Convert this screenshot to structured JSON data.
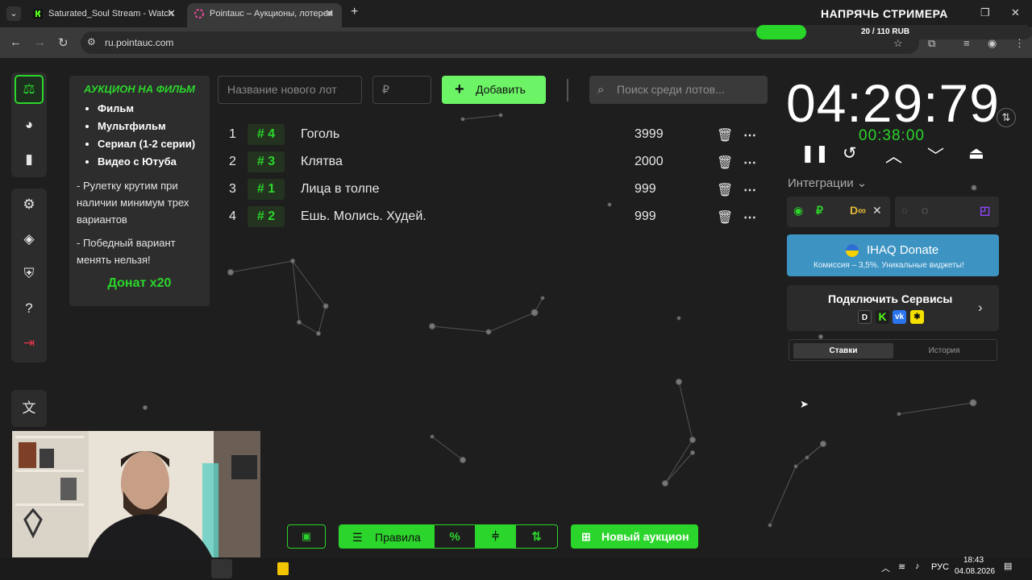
{
  "browser": {
    "tabs": [
      {
        "label": "Saturated_Soul Stream - Watch",
        "active": false
      },
      {
        "label": "Pointauc – Аукционы, лотереи",
        "active": true
      }
    ],
    "url": "ru.pointauc.com"
  },
  "stream_overlay": {
    "title": "НАПРЯЧЬ СТРИМЕРА",
    "progress_text": "20 / 110 RUB",
    "progress_fraction": 0.18
  },
  "sidebar": {
    "top_items": [
      "auction-icon",
      "pie-chart-icon",
      "bar-chart-icon"
    ],
    "mid_items": [
      "gear-icon",
      "layers-icon",
      "shield-icon",
      "help-icon",
      "logout-icon"
    ],
    "bottom_items": [
      "translate-icon"
    ]
  },
  "info_card": {
    "title": "АУКЦИОН НА ФИЛЬМ",
    "items": [
      "Фильм",
      "Мультфильм",
      "Сериал (1-2 серии)",
      "Видео с Ютуба"
    ],
    "rule1": "- Рулетку крутим при наличии минимум трех вариантов",
    "rule2": "- Победный вариант менять нельзя!",
    "donate": "Донат х20"
  },
  "form": {
    "lot_placeholder": "Название нового лот",
    "amount_placeholder": "₽",
    "add_label": "Добавить",
    "search_placeholder": "Поиск среди лотов..."
  },
  "lots": [
    {
      "index": "1",
      "fast": "# 4",
      "name": "Гоголь",
      "amount": "3999"
    },
    {
      "index": "2",
      "fast": "# 3",
      "name": "Клятва",
      "amount": "2000"
    },
    {
      "index": "3",
      "fast": "# 1",
      "name": "Лица в толпе",
      "amount": "999"
    },
    {
      "index": "4",
      "fast": "# 2",
      "name": "Ешь. Молись. Худей.",
      "amount": "999"
    }
  ],
  "timer": {
    "main": "04:29:79",
    "sub": "00:38:00"
  },
  "integrations": {
    "label": "Интеграции",
    "ihaq_title": "IHAQ Donate",
    "ihaq_sub": "Комиссия – 3,5%. Уникальные виджеты!",
    "connect_label": "Подключить Сервисы"
  },
  "history_tabs": {
    "bids": "Ставки",
    "history": "История"
  },
  "toolbar": {
    "rules_label": "Правила",
    "percent_label": "%",
    "new_auction_label": "Новый аукцион"
  },
  "taskbar": {
    "lang": "РУС",
    "time": "18:43",
    "date": "04.08.2026"
  },
  "colors": {
    "accent_green": "#2bd52b",
    "add_button": "#6cf466",
    "ihaq_blue": "#3d94c3",
    "background": "#1e1e1e"
  }
}
